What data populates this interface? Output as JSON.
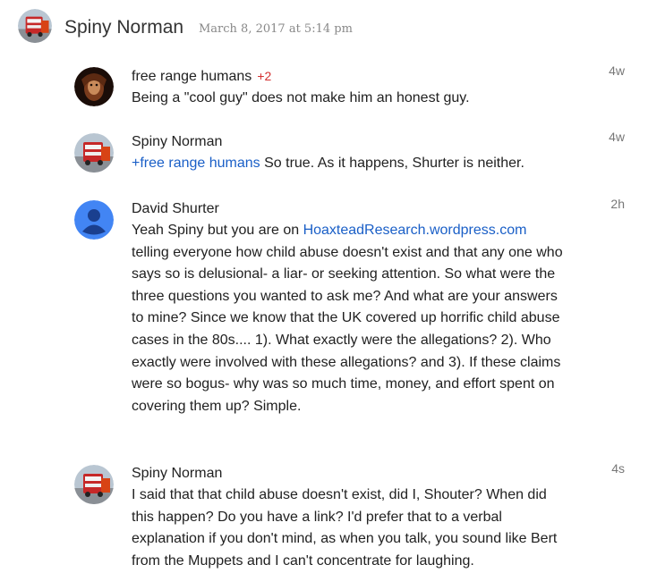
{
  "post": {
    "author": "Spiny Norman",
    "date": "March 8, 2017 at 5:14 pm"
  },
  "replies": [
    {
      "author": "free range humans",
      "plus": "+2",
      "time": "4w",
      "text": "Being a \"cool guy\" does not make him an honest guy."
    },
    {
      "author": "Spiny Norman",
      "time": "4w",
      "mention": "+free range humans",
      "text": " So true. As it happens, Shurter is neither."
    },
    {
      "author": "David Shurter",
      "time": "2h",
      "text_before": "Yeah Spiny but you are on ",
      "link": "HoaxteadResearch.wordpress.com",
      "text_after": " telling everyone how child abuse doesn't exist and that any one who says so is delusional- a liar- or seeking attention.  So what were the three questions you wanted to ask me?  And what are your answers to mine?  Since we know that the UK covered up horrific child abuse cases in the 80s....  1).  What exactly were the allegations?  2).  Who exactly were involved with these allegations?  and 3).  If these claims were so bogus- why was so much time, money, and effort spent on covering them up? Simple."
    },
    {
      "author": "Spiny Norman",
      "time": "4s",
      "text": "I said that that child abuse doesn't exist, did I, Shouter? When did this happen? Do you have a link? I'd prefer that to a verbal explanation if you don't mind, as when you talk, you sound like Bert from the Muppets and I can't concentrate for laughing."
    }
  ],
  "colors": {
    "link": "#1a5fc7",
    "plus_one": "#d32f2f",
    "default_avatar": "#4285f4"
  },
  "icons": {
    "spiny_avatar": "bus-photo-avatar",
    "free_range_avatar": "portrait-photo-avatar",
    "david_avatar": "default-person-avatar"
  }
}
